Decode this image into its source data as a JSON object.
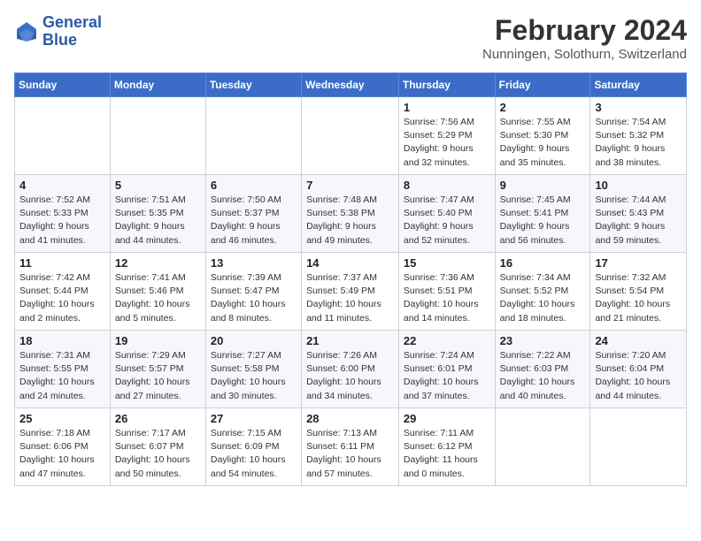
{
  "header": {
    "logo_line1": "General",
    "logo_line2": "Blue",
    "month": "February 2024",
    "location": "Nunningen, Solothurn, Switzerland"
  },
  "weekdays": [
    "Sunday",
    "Monday",
    "Tuesday",
    "Wednesday",
    "Thursday",
    "Friday",
    "Saturday"
  ],
  "weeks": [
    [
      {
        "day": "",
        "info": ""
      },
      {
        "day": "",
        "info": ""
      },
      {
        "day": "",
        "info": ""
      },
      {
        "day": "",
        "info": ""
      },
      {
        "day": "1",
        "info": "Sunrise: 7:56 AM\nSunset: 5:29 PM\nDaylight: 9 hours\nand 32 minutes."
      },
      {
        "day": "2",
        "info": "Sunrise: 7:55 AM\nSunset: 5:30 PM\nDaylight: 9 hours\nand 35 minutes."
      },
      {
        "day": "3",
        "info": "Sunrise: 7:54 AM\nSunset: 5:32 PM\nDaylight: 9 hours\nand 38 minutes."
      }
    ],
    [
      {
        "day": "4",
        "info": "Sunrise: 7:52 AM\nSunset: 5:33 PM\nDaylight: 9 hours\nand 41 minutes."
      },
      {
        "day": "5",
        "info": "Sunrise: 7:51 AM\nSunset: 5:35 PM\nDaylight: 9 hours\nand 44 minutes."
      },
      {
        "day": "6",
        "info": "Sunrise: 7:50 AM\nSunset: 5:37 PM\nDaylight: 9 hours\nand 46 minutes."
      },
      {
        "day": "7",
        "info": "Sunrise: 7:48 AM\nSunset: 5:38 PM\nDaylight: 9 hours\nand 49 minutes."
      },
      {
        "day": "8",
        "info": "Sunrise: 7:47 AM\nSunset: 5:40 PM\nDaylight: 9 hours\nand 52 minutes."
      },
      {
        "day": "9",
        "info": "Sunrise: 7:45 AM\nSunset: 5:41 PM\nDaylight: 9 hours\nand 56 minutes."
      },
      {
        "day": "10",
        "info": "Sunrise: 7:44 AM\nSunset: 5:43 PM\nDaylight: 9 hours\nand 59 minutes."
      }
    ],
    [
      {
        "day": "11",
        "info": "Sunrise: 7:42 AM\nSunset: 5:44 PM\nDaylight: 10 hours\nand 2 minutes."
      },
      {
        "day": "12",
        "info": "Sunrise: 7:41 AM\nSunset: 5:46 PM\nDaylight: 10 hours\nand 5 minutes."
      },
      {
        "day": "13",
        "info": "Sunrise: 7:39 AM\nSunset: 5:47 PM\nDaylight: 10 hours\nand 8 minutes."
      },
      {
        "day": "14",
        "info": "Sunrise: 7:37 AM\nSunset: 5:49 PM\nDaylight: 10 hours\nand 11 minutes."
      },
      {
        "day": "15",
        "info": "Sunrise: 7:36 AM\nSunset: 5:51 PM\nDaylight: 10 hours\nand 14 minutes."
      },
      {
        "day": "16",
        "info": "Sunrise: 7:34 AM\nSunset: 5:52 PM\nDaylight: 10 hours\nand 18 minutes."
      },
      {
        "day": "17",
        "info": "Sunrise: 7:32 AM\nSunset: 5:54 PM\nDaylight: 10 hours\nand 21 minutes."
      }
    ],
    [
      {
        "day": "18",
        "info": "Sunrise: 7:31 AM\nSunset: 5:55 PM\nDaylight: 10 hours\nand 24 minutes."
      },
      {
        "day": "19",
        "info": "Sunrise: 7:29 AM\nSunset: 5:57 PM\nDaylight: 10 hours\nand 27 minutes."
      },
      {
        "day": "20",
        "info": "Sunrise: 7:27 AM\nSunset: 5:58 PM\nDaylight: 10 hours\nand 30 minutes."
      },
      {
        "day": "21",
        "info": "Sunrise: 7:26 AM\nSunset: 6:00 PM\nDaylight: 10 hours\nand 34 minutes."
      },
      {
        "day": "22",
        "info": "Sunrise: 7:24 AM\nSunset: 6:01 PM\nDaylight: 10 hours\nand 37 minutes."
      },
      {
        "day": "23",
        "info": "Sunrise: 7:22 AM\nSunset: 6:03 PM\nDaylight: 10 hours\nand 40 minutes."
      },
      {
        "day": "24",
        "info": "Sunrise: 7:20 AM\nSunset: 6:04 PM\nDaylight: 10 hours\nand 44 minutes."
      }
    ],
    [
      {
        "day": "25",
        "info": "Sunrise: 7:18 AM\nSunset: 6:06 PM\nDaylight: 10 hours\nand 47 minutes."
      },
      {
        "day": "26",
        "info": "Sunrise: 7:17 AM\nSunset: 6:07 PM\nDaylight: 10 hours\nand 50 minutes."
      },
      {
        "day": "27",
        "info": "Sunrise: 7:15 AM\nSunset: 6:09 PM\nDaylight: 10 hours\nand 54 minutes."
      },
      {
        "day": "28",
        "info": "Sunrise: 7:13 AM\nSunset: 6:11 PM\nDaylight: 10 hours\nand 57 minutes."
      },
      {
        "day": "29",
        "info": "Sunrise: 7:11 AM\nSunset: 6:12 PM\nDaylight: 11 hours\nand 0 minutes."
      },
      {
        "day": "",
        "info": ""
      },
      {
        "day": "",
        "info": ""
      }
    ]
  ]
}
